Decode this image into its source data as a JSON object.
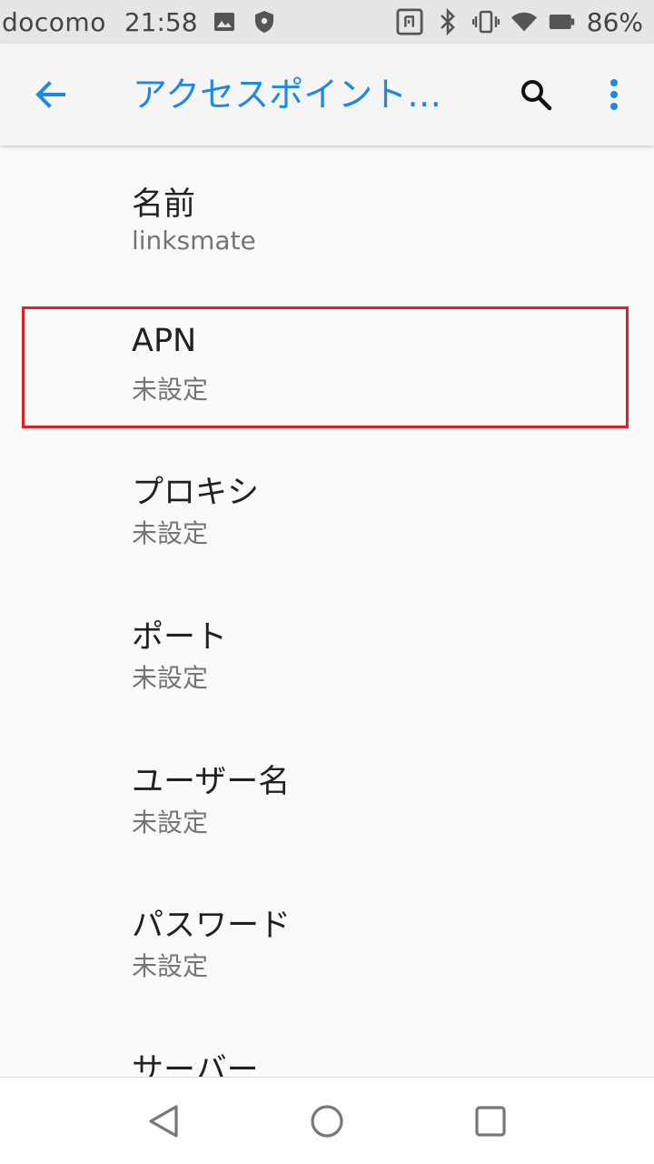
{
  "status_bar": {
    "carrier": "docomo",
    "time": "21:58",
    "battery_percent": "86%",
    "left_icons": [
      "image-icon",
      "shield-icon"
    ],
    "right_icons": [
      "nfc-icon",
      "bluetooth-icon",
      "vibrate-icon",
      "wifi-icon",
      "battery-icon"
    ]
  },
  "app_bar": {
    "title": "アクセスポイント…",
    "accent_color": "#1e88e5",
    "back_icon": "arrow-left-icon",
    "search_icon": "search-icon",
    "more_icon": "more-vert-icon"
  },
  "settings": {
    "items": [
      {
        "title": "名前",
        "summary": "linksmate"
      },
      {
        "title": "APN",
        "summary": "未設定"
      },
      {
        "title": "プロキシ",
        "summary": "未設定"
      },
      {
        "title": "ポート",
        "summary": "未設定"
      },
      {
        "title": "ユーザー名",
        "summary": "未設定"
      },
      {
        "title": "パスワード",
        "summary": "未設定"
      },
      {
        "title": "サーバー",
        "summary": ""
      }
    ],
    "highlighted_item": "APN",
    "highlight_color": "#e02026"
  },
  "nav_bar": {
    "buttons": [
      "back-triangle-icon",
      "home-circle-icon",
      "recents-square-icon"
    ]
  }
}
